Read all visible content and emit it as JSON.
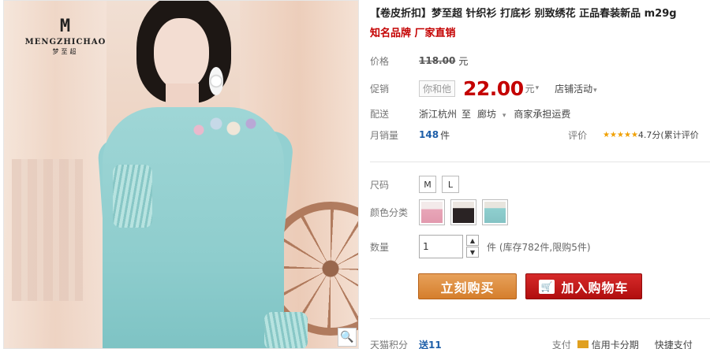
{
  "product_image": {
    "brand_logo_mark": "M",
    "brand_name": "MENGZHICHAO",
    "brand_cn": "梦至超"
  },
  "product": {
    "title": "【卷皮折扣】梦至超 针织衫 打底衫 别致绣花 正品春装新品 m29g",
    "subtitle": "知名品牌 厂家直销"
  },
  "price": {
    "label": "价格",
    "original": "118.00",
    "unit": "元"
  },
  "promo": {
    "label": "促销",
    "tag": "你和他",
    "price": "22.00",
    "unit": "元",
    "shop_activity": "店铺活动"
  },
  "shipping": {
    "label": "配送",
    "from": "浙江杭州",
    "to_word": "至",
    "dest": "廊坊",
    "note": "商家承担运费"
  },
  "sales": {
    "label": "月销量",
    "count": "148",
    "unit": "件",
    "rating_label": "评价",
    "stars": "★★★★★",
    "rating_text": "4.7分(累计评价"
  },
  "size": {
    "label": "尺码",
    "options": [
      "M",
      "L"
    ]
  },
  "color": {
    "label": "颜色分类",
    "options": [
      "pink-sweater",
      "black-sweater",
      "aqua-sweater"
    ]
  },
  "quantity": {
    "label": "数量",
    "value": "1",
    "up": "▲",
    "down": "▼",
    "stock": "件 (库存782件,限购5件)"
  },
  "actions": {
    "buy": "立刻购买",
    "cart": "加入购物车"
  },
  "footer": {
    "points_label": "天猫积分",
    "points_value": "送11",
    "pay_label": "支付",
    "pay_method": "信用卡分期",
    "express_label": "快捷支付"
  },
  "colors": {
    "price_red": "#c40000",
    "buy_orange": "#d57e2c",
    "cart_red": "#b10e0e"
  }
}
